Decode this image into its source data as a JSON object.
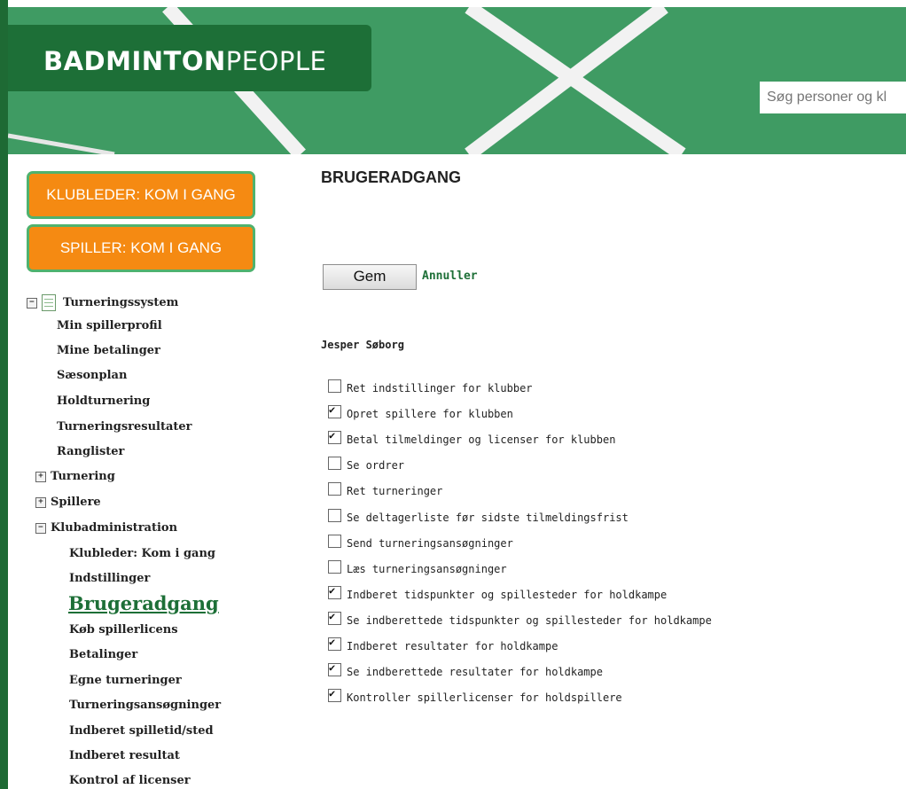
{
  "header": {
    "logo_bold": "BADMINTON",
    "logo_light": "PEOPLE",
    "search_placeholder": "Søg personer og kl"
  },
  "promo_buttons": {
    "club_leader": "KLUBLEDER: KOM I GANG",
    "player": "SPILLER: KOM I GANG"
  },
  "sidebar": {
    "root": "Turneringssystem",
    "items": [
      "Min spillerprofil",
      "Mine betalinger",
      "Sæsonplan",
      "Holdturnering",
      "Turneringsresultater",
      "Ranglister"
    ],
    "groups": [
      "Turnering",
      "Spillere",
      "Klubadministration"
    ],
    "club_items": [
      "Klubleder: Kom i gang",
      "Indstillinger",
      "Brugeradgang",
      "Køb spillerlicens",
      "Betalinger",
      "Egne turneringer",
      "Turneringsansøgninger",
      "Indberet spilletid/sted",
      "Indberet resultat",
      "Kontrol af licenser"
    ]
  },
  "main": {
    "title": "BRUGERADGANG",
    "save_label": "Gem",
    "cancel_label": "Annuller",
    "user_name": "Jesper Søborg",
    "permissions": [
      {
        "label": "Ret indstillinger for klubber",
        "checked": false
      },
      {
        "label": "Opret spillere for klubben",
        "checked": true
      },
      {
        "label": "Betal tilmeldinger og licenser for klubben",
        "checked": true
      },
      {
        "label": "Se ordrer",
        "checked": false
      },
      {
        "label": "Ret turneringer",
        "checked": false
      },
      {
        "label": "Se deltagerliste før sidste tilmeldingsfrist",
        "checked": false
      },
      {
        "label": "Send turneringsansøgninger",
        "checked": false
      },
      {
        "label": "Læs turneringsansøgninger",
        "checked": false
      },
      {
        "label": "Indberet tidspunkter og spillesteder for holdkampe",
        "checked": true
      },
      {
        "label": "Se indberettede tidspunkter og spillesteder for holdkampe",
        "checked": true
      },
      {
        "label": "Indberet resultater for holdkampe",
        "checked": true
      },
      {
        "label": "Se indberettede resultater for holdkampe",
        "checked": true
      },
      {
        "label": "Kontroller spillerlicenser for holdspillere",
        "checked": true
      }
    ]
  }
}
